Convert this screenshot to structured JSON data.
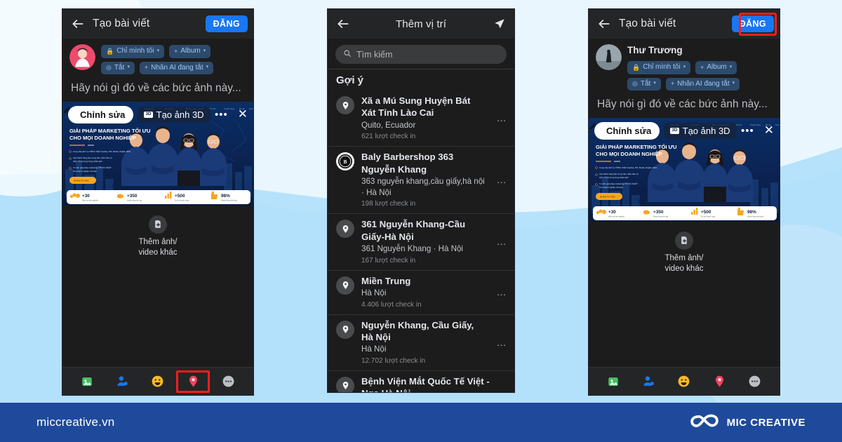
{
  "background": {
    "top_color": "#eaf6fd",
    "bottom_color": "#b9e2fa",
    "accent": "#1f4a9b"
  },
  "panel1": {
    "topbar": {
      "title": "Tạo bài viết",
      "back_icon": "arrow-left-icon",
      "post_label": "ĐĂNG"
    },
    "composer": {
      "avatar": "user-avatar",
      "chips": [
        {
          "icon": "lock-icon",
          "label": "Chỉ mình tôi",
          "caret": "▾"
        },
        {
          "icon": "plus-icon",
          "label": "Album",
          "caret": "▾"
        },
        {
          "icon": "camera-icon",
          "label": "Tắt",
          "caret": "▾"
        },
        {
          "icon": "plus-icon",
          "label": "Nhãn AI đang tắt",
          "caret": "▾"
        }
      ],
      "placeholder": "Hãy nói gì đó về các bức ảnh này..."
    },
    "banner": {
      "edit_label": "Chỉnh sửa",
      "edit_icon": "pencil-icon",
      "threed_label": "Tạo ảnh 3D",
      "threed_badge": "3D",
      "more_icon": "ellipsis-icon",
      "close_icon": "close-icon",
      "headline_line1": "GIẢI PHÁP MARKETING TỐI ƯU",
      "headline_line2": "CHO MỌI DOANH NGHIỆP",
      "bullets": [
        "Cung cấp dịch vụ TỔNG THỂ Creative, PR, Media, Digital, SEO...",
        "Lấy khách hàng làm trọng tâm, đảm bảo sự HÀI LÒNG trong từng chiến dịch",
        "Tư vấn giải pháp marketing TỐI ƯU NHẤT cho doanh nghiệp của bạn"
      ],
      "cta": "NHẬN TƯ VẤN",
      "nav": [
        "Trang chủ",
        "Giới thiệu",
        "Dịch vụ tổng quát",
        "Tin tức",
        "Tuyển dụng",
        "Dự án",
        "Liên hệ"
      ],
      "stats": [
        {
          "icon": "people-icon",
          "value": "+30",
          "label": "Năm sự kinh nghiệm"
        },
        {
          "icon": "handshake-icon",
          "value": "+350",
          "label": "Khách hàng tin cậy"
        },
        {
          "icon": "chart-icon",
          "value": "+500",
          "label": "Dự án thành công"
        },
        {
          "icon": "thumbsup-icon",
          "value": "98%",
          "label": "Khách hàng hài lòng"
        }
      ]
    },
    "add_more": {
      "icon": "add-photo-icon",
      "line1": "Thêm ảnh/",
      "line2": "video khác"
    },
    "toolbar": [
      {
        "name": "photo-icon",
        "label": "Ảnh/Video"
      },
      {
        "name": "tag-people-icon",
        "label": "Gắn thẻ người khác"
      },
      {
        "name": "feeling-icon",
        "label": "Cảm xúc/Hoạt động"
      },
      {
        "name": "location-pin-icon",
        "label": "Check in",
        "highlighted": true
      },
      {
        "name": "more-options-icon",
        "label": "Xem thêm"
      }
    ]
  },
  "panel2": {
    "topbar": {
      "title": "Thêm vị trí",
      "back_icon": "arrow-left-icon",
      "send_icon": "send-location-icon"
    },
    "search": {
      "icon": "search-icon",
      "placeholder": "Tìm kiếm",
      "value": ""
    },
    "section_title": "Gợi ý",
    "locations": [
      {
        "icon": "location-pin-icon",
        "name": "Xã a Mú Sung Huyện Bát Xát Tỉnh Lào Cai",
        "sub": "Quito, Ecuador",
        "checkins": "621 lượt check in",
        "menu": "…"
      },
      {
        "icon": "business-logo-icon",
        "name": "Baly Barbershop 363 Nguyễn Khang",
        "sub": "363 nguyễn khang,cầu giấy,hà nội · Hà Nội",
        "checkins": "198 lượt check in",
        "menu": "…"
      },
      {
        "icon": "location-pin-icon",
        "name": "361 Nguyễn Khang-Cầu Giấy-Hà Nội",
        "sub": "361 Nguyễn Khang · Hà Nội",
        "checkins": "167 lượt check in",
        "menu": "…"
      },
      {
        "icon": "location-pin-icon",
        "name": "Miền Trung",
        "sub": "Hà Nội",
        "checkins": "4.406 lượt check in",
        "menu": "…"
      },
      {
        "icon": "location-pin-icon",
        "name": "Nguyễn Khang, Cầu Giấy, Hà Nội",
        "sub": "Hà Nội",
        "checkins": "12.702 lượt check in",
        "menu": "…"
      },
      {
        "icon": "location-pin-icon",
        "name": "Bệnh Viện Mắt Quốc Tế Việt - Nga Hà Nội",
        "sub": "",
        "checkins": "",
        "menu": ""
      }
    ]
  },
  "panel3": {
    "topbar": {
      "title": "Tạo bài viết",
      "back_icon": "arrow-left-icon",
      "post_label": "ĐĂNG",
      "post_highlighted": true
    },
    "composer": {
      "avatar": "user-avatar",
      "user_name": "Thư Trương",
      "chips": [
        {
          "icon": "lock-icon",
          "label": "Chỉ mình tôi",
          "caret": "▾"
        },
        {
          "icon": "plus-icon",
          "label": "Album",
          "caret": "▾"
        },
        {
          "icon": "camera-icon",
          "label": "Tắt",
          "caret": "▾"
        },
        {
          "icon": "plus-icon",
          "label": "Nhãn AI đang tắt",
          "caret": "▾"
        }
      ],
      "placeholder": "Hãy nói gì đó về các bức ảnh này..."
    },
    "add_more": {
      "icon": "add-photo-icon",
      "line1": "Thêm ảnh/",
      "line2": "video khác"
    }
  },
  "footer": {
    "url": "miccreative.vn",
    "brand": "MIC CREATIVE",
    "logo_icon": "infinity-logo-icon"
  }
}
